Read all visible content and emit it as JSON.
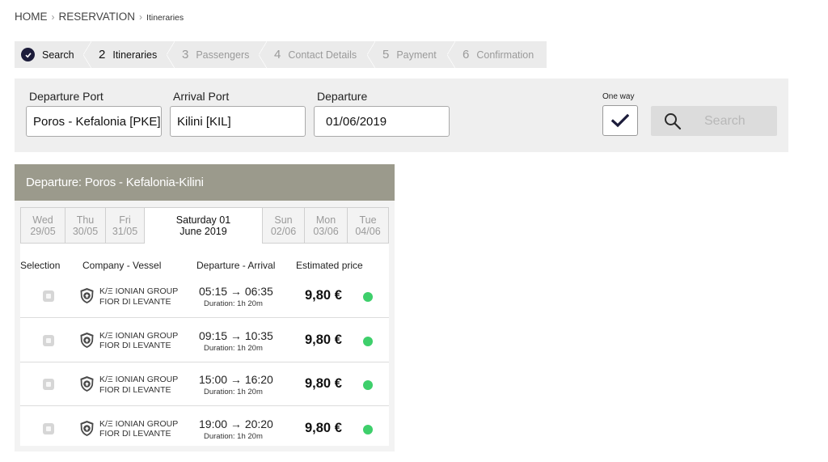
{
  "breadcrumb": {
    "home": "HOME",
    "reservation": "RESERVATION",
    "current": "Itineraries",
    "separator": "›"
  },
  "steps": [
    {
      "num": "",
      "label": "Search",
      "state": "done"
    },
    {
      "num": "2",
      "label": "Itineraries",
      "state": "active"
    },
    {
      "num": "3",
      "label": "Passengers",
      "state": "pending"
    },
    {
      "num": "4",
      "label": "Contact Details",
      "state": "pending"
    },
    {
      "num": "5",
      "label": "Payment",
      "state": "pending"
    },
    {
      "num": "6",
      "label": "Confirmation",
      "state": "pending"
    }
  ],
  "search": {
    "departure_port_label": "Departure Port",
    "departure_port_value": "Poros - Kefalonia  [PKE]",
    "arrival_port_label": "Arrival Port",
    "arrival_port_value": "Kilini  [KIL]",
    "departure_label": "Departure",
    "departure_value": "01/06/2019",
    "one_way_label": "One way",
    "one_way_checked": true,
    "search_button": "Search"
  },
  "results": {
    "header": "Departure: Poros - Kefalonia-Kilini",
    "days": [
      {
        "l1": "Wed",
        "l2": "29/05",
        "selected": false
      },
      {
        "l1": "Thu",
        "l2": "30/05",
        "selected": false
      },
      {
        "l1": "Fri",
        "l2": "31/05",
        "selected": false
      },
      {
        "l1": "Saturday 01",
        "l2": "June 2019",
        "selected": true
      },
      {
        "l1": "Sun",
        "l2": "02/06",
        "selected": false
      },
      {
        "l1": "Mon",
        "l2": "03/06",
        "selected": false
      },
      {
        "l1": "Tue",
        "l2": "04/06",
        "selected": false
      }
    ],
    "columns": {
      "selection": "Selection",
      "company": "Company - Vessel",
      "times": "Departure - Arrival",
      "price": "Estimated price"
    },
    "rows": [
      {
        "company": "K/Ξ IONIAN GROUP",
        "vessel": "FIOR DI LEVANTE",
        "times": "05:15 → 06:35",
        "duration": "Duration: 1h 20m",
        "price": "9,80 €"
      },
      {
        "company": "K/Ξ IONIAN GROUP",
        "vessel": "FIOR DI LEVANTE",
        "times": "09:15 → 10:35",
        "duration": "Duration: 1h 20m",
        "price": "9,80 €"
      },
      {
        "company": "K/Ξ IONIAN GROUP",
        "vessel": "FIOR DI LEVANTE",
        "times": "15:00 → 16:20",
        "duration": "Duration: 1h 20m",
        "price": "9,80 €"
      },
      {
        "company": "K/Ξ IONIAN GROUP",
        "vessel": "FIOR DI LEVANTE",
        "times": "19:00 → 20:20",
        "duration": "Duration: 1h 20m",
        "price": "9,80 €"
      }
    ],
    "availability_color": "#3ecf6b"
  },
  "colors": {
    "header_bg": "#9b9a8c",
    "step_check": "#1c1c3a"
  },
  "icons": [
    "check-circle-icon",
    "check-icon",
    "search-icon",
    "ferry-company-logo-icon",
    "availability-dot-icon"
  ]
}
